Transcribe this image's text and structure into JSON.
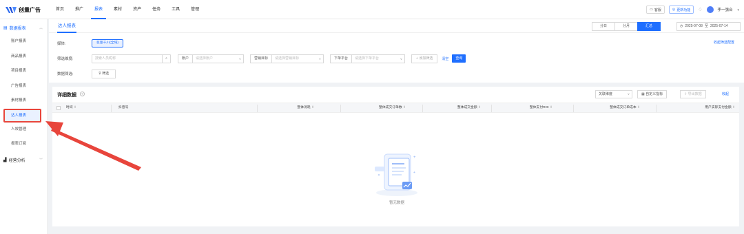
{
  "app": {
    "logo_text": "创量广告"
  },
  "nav": [
    "首页",
    "推广",
    "报表",
    "素材",
    "资产",
    "任务",
    "工具",
    "管理"
  ],
  "nav_active_index": 2,
  "top_right": {
    "btn1": "客服",
    "btn2": "更新功能",
    "user": "李一强合"
  },
  "sidebar": {
    "group1": "数据报表",
    "items": [
      "账户报表",
      "商品报表",
      "项目报表",
      "广告报表",
      "素材报表",
      "达人报表",
      "人效管理",
      "报表订阅"
    ],
    "active_index": 5,
    "group2": "经营分析"
  },
  "page": {
    "tab": "达人报表",
    "segments": [
      "分日",
      "分月",
      "汇总"
    ],
    "active_segment": 2,
    "date_start": "2025-07-08",
    "date_sep": "至",
    "date_end": "2025-07-14",
    "right_link": "收起筛选配置"
  },
  "filters": {
    "media_label": "媒体:",
    "media_value": "巨量千川(全域)",
    "dim_label": "筛选维度:",
    "search_placeholder": "搜索人员昵称",
    "account_key": "账户",
    "account_placeholder": "请选择账户",
    "goal_key": "营销目标",
    "goal_placeholder": "请选择营销目标",
    "platform_key": "下单平台",
    "platform_placeholder": "请选择下单平台",
    "add_filter": "+ 添加筛选",
    "clear": "清空",
    "query": "查询",
    "data_label": "数据筛选:",
    "data_filter_btn": "筛选"
  },
  "detail": {
    "title": "详细数据",
    "assoc_select": "关联维度",
    "custom_btn": "自定义指标",
    "export_btn": "导出数据",
    "collapse": "收起",
    "columns": [
      "时间",
      "抖音号",
      "整体消耗",
      "整体成交订单数",
      "整体成交金额",
      "整体支付ROI",
      "整体成交订单成本",
      "用户实际支付金额"
    ],
    "empty_text": "暂无数据"
  },
  "colors": {
    "accent": "#1f6fff",
    "highlight": "#e8453c"
  }
}
